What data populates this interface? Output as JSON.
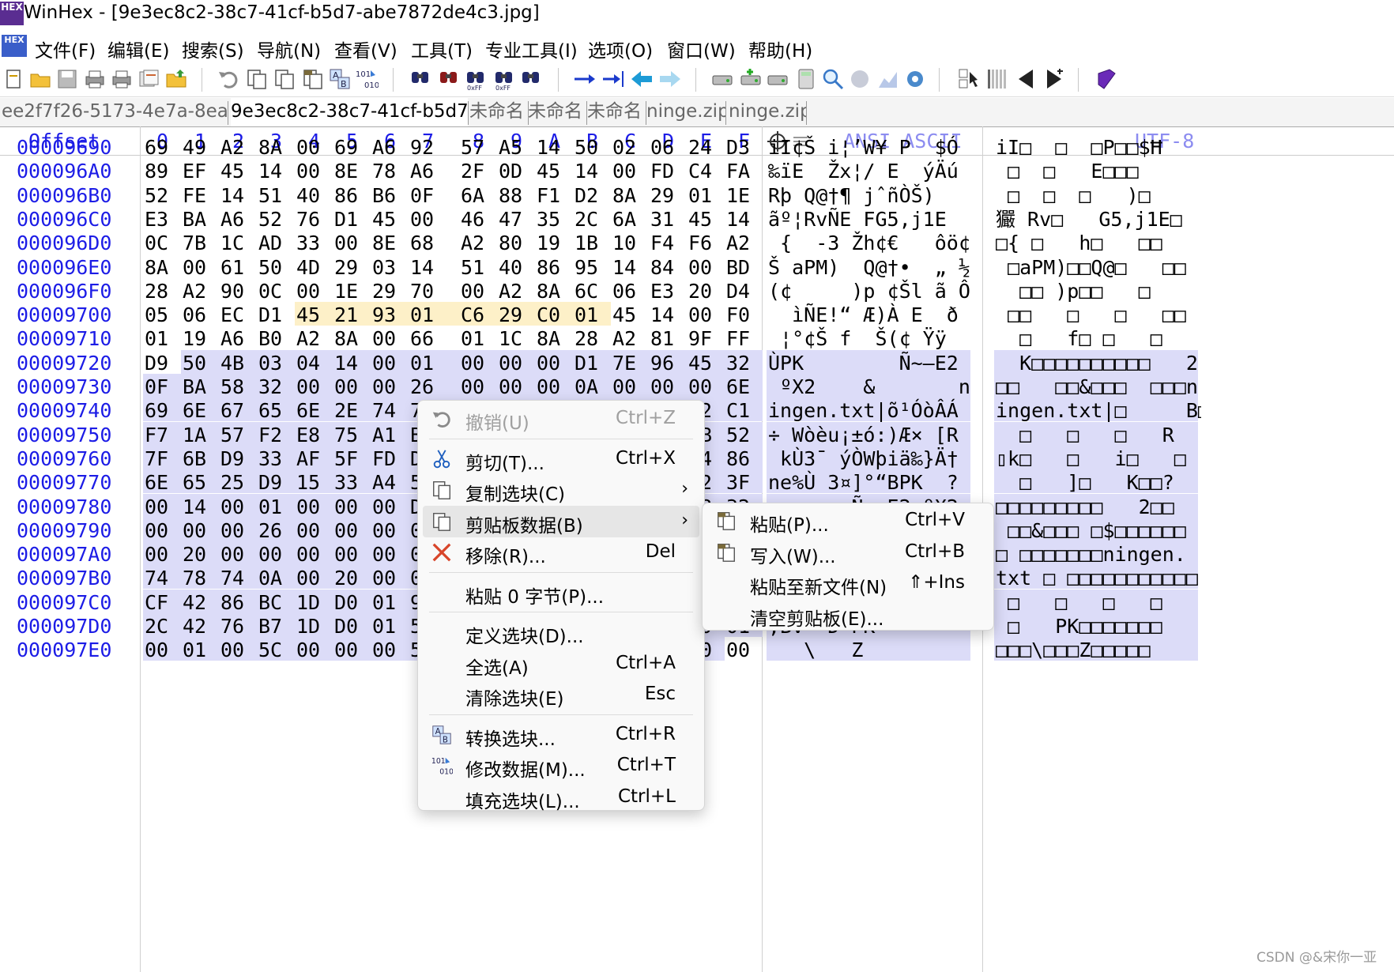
{
  "window": {
    "title": "WinHex - [9e3ec8c2-38c7-41cf-b5d7-abe7872de4c3.jpg]",
    "logo": "HEX"
  },
  "menubar": [
    {
      "label": "文件(F)"
    },
    {
      "label": "编辑(E)"
    },
    {
      "label": "搜索(S)"
    },
    {
      "label": "导航(N)"
    },
    {
      "label": "查看(V)"
    },
    {
      "label": "工具(T)"
    },
    {
      "label": "专业工具(I)"
    },
    {
      "label": "选项(O)"
    },
    {
      "label": "窗口(W)"
    },
    {
      "label": "帮助(H)"
    }
  ],
  "toolbar_icons": [
    "new-icon",
    "open-folder-icon",
    "save-icon",
    "print-icon",
    "printer-icon",
    "properties-icon",
    "open-folder-up-icon",
    "undo-icon",
    "copy-icon",
    "copy-block-icon",
    "paste-icon",
    "convert-icon",
    "modify-data-icon",
    "find-text-icon",
    "find-hex-icon",
    "replace-hex-icon",
    "replace-text-icon",
    "find-icon",
    "goto-offset-icon",
    "goto-sector-icon",
    "back-icon",
    "forward-icon",
    "disk-icon",
    "ram-icon",
    "chip-icon",
    "calculator-icon",
    "magnifier-icon",
    "disk-map-icon",
    "chart-icon",
    "settings-icon",
    "data-interpreter-icon",
    "columns-icon",
    "previous-icon",
    "next-icon",
    "book-icon"
  ],
  "tabs": [
    {
      "label": "ee2f7f26-5173-4e7a-8ea4-..."
    },
    {
      "label": "9e3ec8c2-38c7-41cf-b5d7-..."
    },
    {
      "label": "未命名"
    },
    {
      "label": "未命名"
    },
    {
      "label": "未命名"
    },
    {
      "label": "ninge.zip"
    },
    {
      "label": "ninge.zip"
    }
  ],
  "header": {
    "offset": "Offset",
    "cols": [
      "0",
      "1",
      "2",
      "3",
      "4",
      "5",
      "6",
      "7",
      "8",
      "9",
      "A",
      "B",
      "C",
      "D",
      "E",
      "F"
    ],
    "ansi": "ANSI ASCII",
    "utf8": "UTF-8"
  },
  "colors": {
    "selection": "#dcdcf8",
    "highlight": "#fdf0c8",
    "offset_blue": "#1c1ce6"
  },
  "rows": [
    {
      "offset": "00009690",
      "hex": [
        "69",
        "49",
        "A2",
        "8A",
        "00",
        "69",
        "A6",
        "92",
        "57",
        "A5",
        "14",
        "50",
        "02",
        "06",
        "24",
        "D3"
      ],
      "ansi": "iI¢Š i¦’W¥ P  $Ó",
      "utf8": "iI□  □  □P□□$Ħ",
      "sel_from": 16
    },
    {
      "offset": "000096A0",
      "hex": [
        "89",
        "EF",
        "45",
        "14",
        "00",
        "8E",
        "78",
        "A6",
        "2F",
        "0D",
        "45",
        "14",
        "00",
        "FD",
        "C4",
        "FA"
      ],
      "ansi": "‰ïE  Žx¦/ E  ýÄú",
      "utf8": " □  □   E□□□",
      "sel_from": 16
    },
    {
      "offset": "000096B0",
      "hex": [
        "52",
        "FE",
        "14",
        "51",
        "40",
        "86",
        "B6",
        "0F",
        "6A",
        "88",
        "F1",
        "D2",
        "8A",
        "29",
        "01",
        "1E"
      ],
      "ansi": "Rþ Q@†¶ jˆñÒŠ)",
      "utf8": " □  □  □   )□",
      "sel_from": 16
    },
    {
      "offset": "000096C0",
      "hex": [
        "E3",
        "BA",
        "A6",
        "52",
        "76",
        "D1",
        "45",
        "00",
        "46",
        "47",
        "35",
        "2C",
        "6A",
        "31",
        "45",
        "14"
      ],
      "ansi": "ãº¦RvÑE FG5,j1E",
      "utf8": "玁 Rv□   G5,j1E□",
      "sel_from": 16
    },
    {
      "offset": "000096D0",
      "hex": [
        "0C",
        "7B",
        "1C",
        "AD",
        "33",
        "00",
        "8E",
        "68",
        "A2",
        "80",
        "19",
        "1B",
        "10",
        "F4",
        "F6",
        "A2"
      ],
      "ansi": " {  -3 Žh¢€   ôö¢",
      "utf8": "□{ □   h□   □□",
      "sel_from": 16
    },
    {
      "offset": "000096E0",
      "hex": [
        "8A",
        "00",
        "61",
        "50",
        "4D",
        "29",
        "03",
        "14",
        "51",
        "40",
        "86",
        "95",
        "14",
        "84",
        "00",
        "BD"
      ],
      "ansi": "Š aPM)  Q@†•  „ ½",
      "utf8": " □aPM)□□Q@□   □□",
      "sel_from": 16
    },
    {
      "offset": "000096F0",
      "hex": [
        "28",
        "A2",
        "90",
        "0C",
        "00",
        "1E",
        "29",
        "70",
        "00",
        "A2",
        "8A",
        "6C",
        "06",
        "E3",
        "20",
        "D4"
      ],
      "ansi": "(¢     )p ¢Šl ã Ô",
      "utf8": "  □□ )p□□   □",
      "sel_from": 16
    },
    {
      "offset": "00009700",
      "hex": [
        "05",
        "06",
        "EC",
        "D1",
        "45",
        "21",
        "93",
        "01",
        "C6",
        "29",
        "C0",
        "01",
        "45",
        "14",
        "00",
        "F0"
      ],
      "ansi": "  ìÑE!“ Æ)À E  ð",
      "utf8": " □□   □   □   □□",
      "sel_from": 16,
      "hl_from": 4,
      "hl_to": 11
    },
    {
      "offset": "00009710",
      "hex": [
        "01",
        "19",
        "A6",
        "B0",
        "A2",
        "8A",
        "00",
        "66",
        "01",
        "1C",
        "8A",
        "28",
        "A2",
        "81",
        "9F",
        "FF"
      ],
      "ansi": " ¦°¢Š f  Š(¢ Ÿÿ",
      "utf8": "  □   f□ □   □",
      "sel_from": 16
    },
    {
      "offset": "00009720",
      "hex": [
        "D9",
        "50",
        "4B",
        "03",
        "04",
        "14",
        "00",
        "01",
        "00",
        "00",
        "00",
        "D1",
        "7E",
        "96",
        "45",
        "32"
      ],
      "ansi": "ÙPK        Ñ~–E2",
      "utf8": "  K□□□□□□□□□□   2",
      "sel_from": 1
    },
    {
      "offset": "00009730",
      "hex": [
        "0F",
        "BA",
        "58",
        "32",
        "00",
        "00",
        "00",
        "26",
        "00",
        "00",
        "00",
        "0A",
        "00",
        "00",
        "00",
        "6E"
      ],
      "ansi": " ºX2    &       n",
      "utf8": "□□   □□&□□□  □□□n",
      "sel_from": 0
    },
    {
      "offset": "00009740",
      "hex": [
        "69",
        "6E",
        "67",
        "65",
        "6E",
        "2E",
        "74",
        "78",
        "74",
        "7C",
        "F5",
        "B9",
        "D3",
        "F2",
        "C2",
        "C1"
      ],
      "ansi": "ingen.txt|õ¹ÓòÂÁ",
      "utf8": "ingen.txt|□     B□",
      "sel_from": 0
    },
    {
      "offset": "00009750",
      "hex": [
        "F7",
        "1A",
        "57",
        "F2",
        "E8",
        "75",
        "A1",
        "B1",
        "F3",
        "3A",
        "29",
        "C6",
        "D7",
        "20",
        "5B",
        "52"
      ],
      "ansi": "÷ Wòèu¡±ó:)Æ× [R",
      "utf8": "  □   □   □   R",
      "sel_from": 0
    },
    {
      "offset": "00009760",
      "hex": [
        "7F",
        "6B",
        "D9",
        "33",
        "AF",
        "5F",
        "FD",
        "D2",
        "57",
        "FE",
        "69",
        "E4",
        "89",
        "7D",
        "C4",
        "86"
      ],
      "ansi": " kÙ3¯_ýÒWþiä‰}Ä†",
      "utf8": "▯k□   □   i□   □",
      "sel_from": 0
    },
    {
      "offset": "00009770",
      "hex": [
        "6E",
        "65",
        "25",
        "D9",
        "15",
        "33",
        "A4",
        "5D",
        "B0",
        "93",
        "42",
        "50",
        "4B",
        "01",
        "02",
        "3F"
      ],
      "ansi": "ne%Ù 3¤]°“BPK  ?",
      "utf8": "  □   ]□   K□□?",
      "sel_from": 0
    },
    {
      "offset": "00009780",
      "hex": [
        "00",
        "14",
        "00",
        "01",
        "00",
        "00",
        "00",
        "D1",
        "7E",
        "96",
        "45",
        "32",
        "0F",
        "BA",
        "58",
        "32"
      ],
      "ansi": "       Ñ~–E2 ºX2",
      "utf8": "□□□□□□□□□   2□□",
      "sel_from": 0
    },
    {
      "offset": "00009790",
      "hex": [
        "00",
        "00",
        "00",
        "26",
        "00",
        "00",
        "00",
        "0A",
        "00",
        "24",
        "00",
        "00",
        "00",
        "00",
        "00",
        "00"
      ],
      "ansi": "   &      $      ",
      "utf8": " □□&□□□ □$□□□□□□",
      "sel_from": 0
    },
    {
      "offset": "000097A0",
      "hex": [
        "00",
        "20",
        "00",
        "00",
        "00",
        "00",
        "00",
        "00",
        "00",
        "00",
        "6E",
        "69",
        "6E",
        "67",
        "65",
        "6E"
      ],
      "ansi": "          ningen",
      "utf8": "□ □□□□□□□ningen.",
      "sel_from": 0
    },
    {
      "offset": "000097B0",
      "hex": [
        "74",
        "78",
        "74",
        "0A",
        "00",
        "20",
        "00",
        "00",
        "00",
        "00",
        "00",
        "00",
        "00",
        "00",
        "00",
        "01"
      ],
      "ansi": "txt             ",
      "utf8": "txt □ □□□□□□□□□□□",
      "sel_from": 0
    },
    {
      "offset": "000097C0",
      "hex": [
        "CF",
        "42",
        "86",
        "BC",
        "1D",
        "D0",
        "01",
        "9E",
        "5F",
        "B7",
        "1D",
        "D0",
        "01",
        "DE",
        "28",
        "97"
      ],
      "ansi": "ÏB†¼ Ð ž_· Ð Þ(—",
      "utf8": " □   □   □   □",
      "sel_from": 0
    },
    {
      "offset": "000097D0",
      "hex": [
        "2C",
        "42",
        "76",
        "B7",
        "1D",
        "D0",
        "01",
        "50",
        "4B",
        "05",
        "06",
        "00",
        "00",
        "00",
        "00",
        "01"
      ],
      "ansi": ",Bv· Ð PK       ",
      "utf8": " □   PK□□□□□□□",
      "sel_from": 0
    },
    {
      "offset": "000097E0",
      "hex": [
        "00",
        "01",
        "00",
        "5C",
        "00",
        "00",
        "00",
        "5A",
        "00",
        "00",
        "00",
        "00",
        "00",
        "00",
        "00",
        "00"
      ],
      "ansi": "   \\   Z        ",
      "utf8": "□□□\\□□□Z□□□□□",
      "sel_from": 0,
      "sel_to": 14
    }
  ],
  "context_menu": {
    "items": [
      {
        "label": "撤销(U)",
        "shortcut": "Ctrl+Z",
        "icon": "undo-icon",
        "disabled": true
      },
      {
        "sep": true
      },
      {
        "label": "剪切(T)...",
        "shortcut": "Ctrl+X",
        "icon": "scissors-icon"
      },
      {
        "label": "复制选块(C)",
        "shortcut": "",
        "icon": "copy-icon",
        "submenu": true
      },
      {
        "label": "剪贴板数据(B)",
        "shortcut": "",
        "icon": "clipboard-icon",
        "submenu": true,
        "highlight": true
      },
      {
        "label": "移除(R)...",
        "shortcut": "Del",
        "icon": "remove-x-icon"
      },
      {
        "sep": true
      },
      {
        "label": "粘贴 0 字节(P)...",
        "shortcut": "",
        "icon": ""
      },
      {
        "sep": true
      },
      {
        "label": "定义选块(D)...",
        "shortcut": "",
        "icon": ""
      },
      {
        "label": "全选(A)",
        "shortcut": "Ctrl+A",
        "icon": ""
      },
      {
        "label": "清除选块(E)",
        "shortcut": "Esc",
        "icon": ""
      },
      {
        "sep": true
      },
      {
        "label": "转换选块...",
        "shortcut": "Ctrl+R",
        "icon": "convert-icon"
      },
      {
        "label": "修改数据(M)...",
        "shortcut": "Ctrl+T",
        "icon": "modify-data-icon"
      },
      {
        "label": "填充选块(L)...",
        "shortcut": "Ctrl+L",
        "icon": ""
      }
    ]
  },
  "submenu": {
    "items": [
      {
        "label": "粘贴(P)...",
        "shortcut": "Ctrl+V",
        "icon": "paste-icon"
      },
      {
        "label": "写入(W)...",
        "shortcut": "Ctrl+B",
        "icon": "write-icon"
      },
      {
        "label": "粘贴至新文件(N)",
        "shortcut": "⇑+Ins",
        "icon": ""
      },
      {
        "label": "清空剪贴板(E)...",
        "shortcut": "",
        "icon": ""
      }
    ]
  },
  "watermark": "CSDN @&宋你一亚"
}
